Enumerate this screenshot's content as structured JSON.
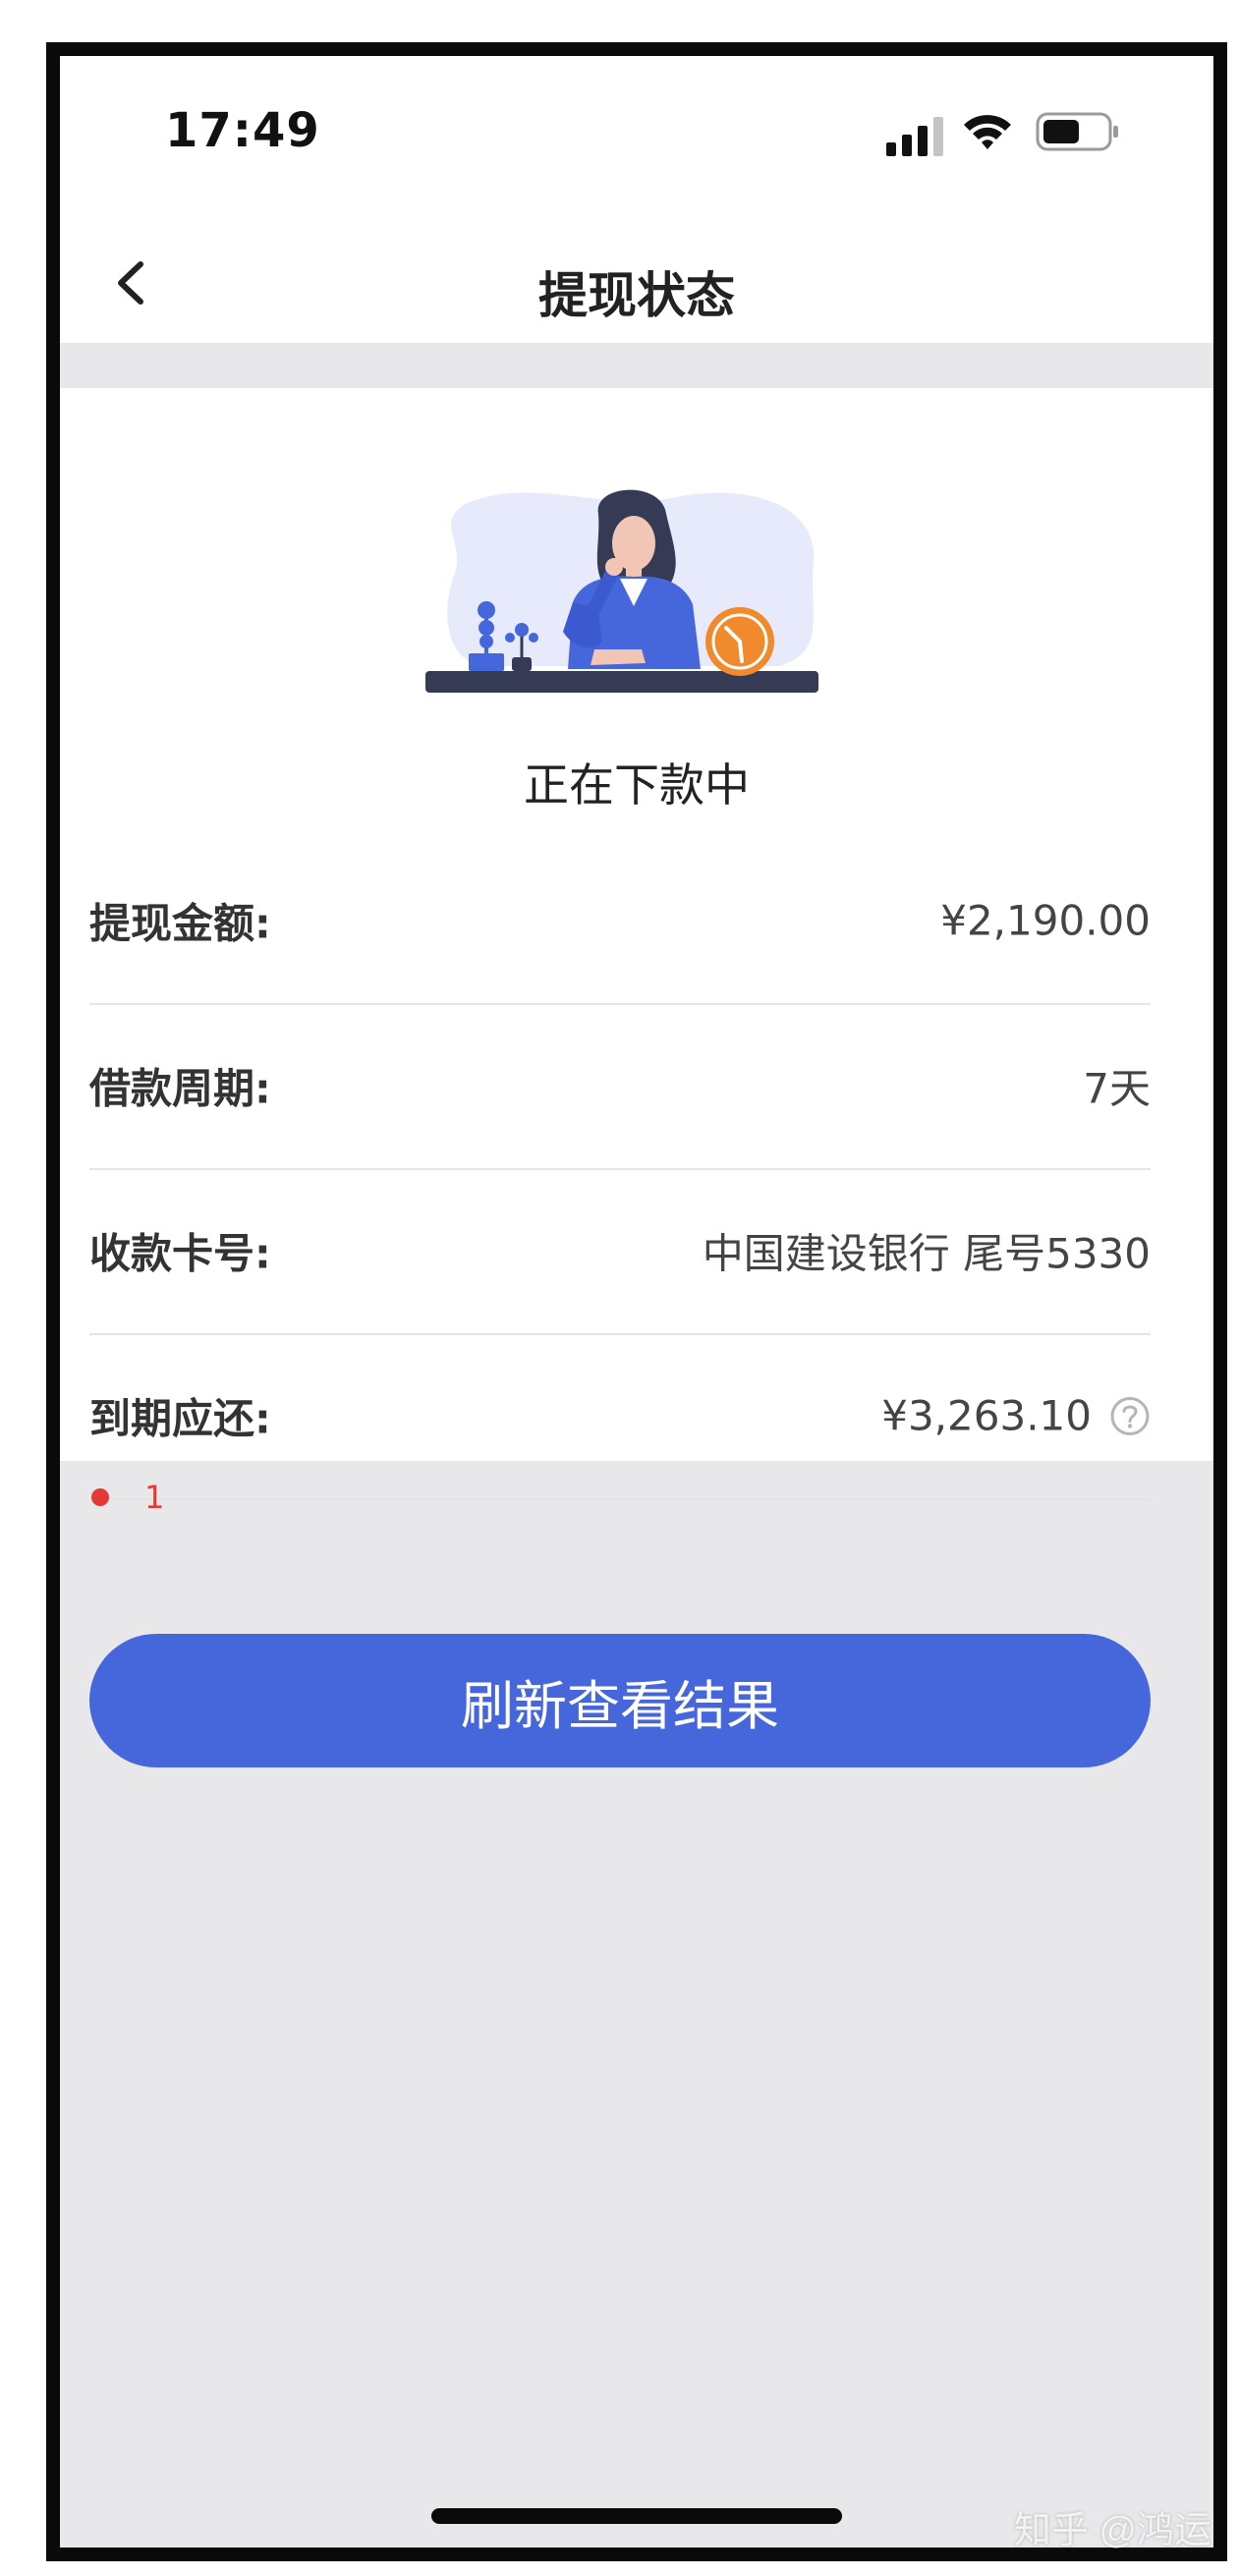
{
  "status_bar": {
    "time": "17:49"
  },
  "nav": {
    "title": "提现状态"
  },
  "status": {
    "text": "正在下款中"
  },
  "details": [
    {
      "label": "提现金额:",
      "value": "¥2,190.00"
    },
    {
      "label": "借款周期:",
      "value": "7天"
    },
    {
      "label": "收款卡号:",
      "value": "中国建设银行 尾号5330"
    },
    {
      "label": "到期应还:",
      "value": "¥3,263.10"
    }
  ],
  "note": {
    "text": "1"
  },
  "actions": {
    "refresh_label": "刷新查看结果"
  },
  "watermark": {
    "text": "知乎 @鸿运"
  },
  "colors": {
    "accent": "#4667db",
    "alert": "#e53935",
    "page_bg": "#e8e8ea",
    "illustration_clock": "#f08a2a"
  }
}
